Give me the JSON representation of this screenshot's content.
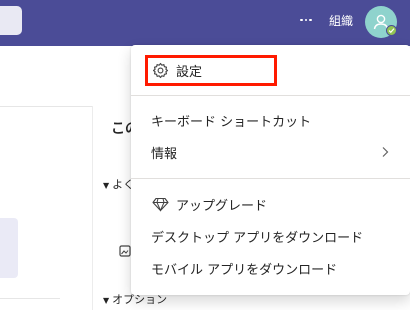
{
  "header": {
    "more_label": "…",
    "org_label": "組織",
    "avatar": "person-avatar",
    "presence": "available"
  },
  "background": {
    "panel_title": "この",
    "section_1": "よく",
    "section_2": "オプション"
  },
  "menu": {
    "settings": "設定",
    "keyboard_shortcuts": "キーボード ショートカット",
    "info": "情報",
    "upgrade": "アップグレード",
    "desktop_app": "デスクトップ アプリをダウンロード",
    "mobile_app": "モバイル アプリをダウンロード"
  },
  "colors": {
    "header": "#4b4c97",
    "avatar": "#8fd3cd",
    "presence": "#92c353",
    "highlight": "#ff1a00"
  }
}
